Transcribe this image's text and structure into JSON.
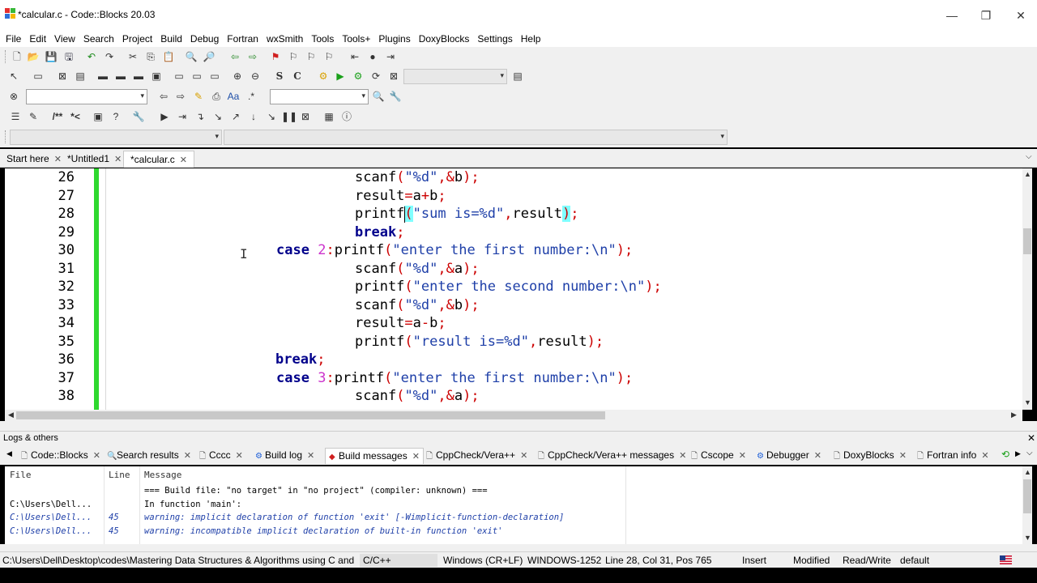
{
  "window": {
    "title": "*calcular.c - Code::Blocks 20.03",
    "minimize_glyph": "—",
    "restore_glyph": "❐",
    "close_glyph": "✕"
  },
  "menu": [
    "File",
    "Edit",
    "View",
    "Search",
    "Project",
    "Build",
    "Debug",
    "Fortran",
    "wxSmith",
    "Tools",
    "Tools+",
    "Plugins",
    "DoxyBlocks",
    "Settings",
    "Help"
  ],
  "toolbar": {
    "icons": [
      "new-file-icon",
      "open-icon",
      "save-icon",
      "save-all-icon",
      "undo-icon",
      "redo-icon",
      "cut-icon",
      "copy-icon",
      "paste-icon",
      "find-icon",
      "replace-icon",
      "jump-back-icon",
      "jump-forward-icon",
      "bookmark-toggle-icon",
      "bookmark-prev-icon",
      "bookmark-next-icon",
      "bookmark-clear-icon",
      "nav-prev-icon",
      "nav-mark-icon",
      "nav-next-icon"
    ],
    "build_target_placeholder": "",
    "search_placeholder": "",
    "symbols": [
      "S",
      "C"
    ]
  },
  "tabs": [
    {
      "label": "Start here",
      "active": false
    },
    {
      "label": "*Untitled1",
      "active": false
    },
    {
      "label": "*calcular.c",
      "active": true
    }
  ],
  "editor": {
    "lines": [
      26,
      27,
      28,
      29,
      30,
      31,
      32,
      33,
      34,
      35,
      36,
      37,
      38
    ],
    "code": [
      "scanf(\"%d\",&b);",
      "result=a+b;",
      "printf(\"sum is=%d\",result);",
      "break;",
      "case 2:printf(\"enter the first number:\\n\");",
      "scanf(\"%d\",&a);",
      "printf(\"enter the second number:\\n\");",
      "scanf(\"%d\",&b);",
      "result=a-b;",
      "printf(\"result is=%d\",result);",
      "break;",
      "case 3:printf(\"enter the first number:\\n\");",
      "scanf(\"%d\",&a);"
    ]
  },
  "logs": {
    "title": "Logs & others",
    "tabs": [
      {
        "label": "Code::Blocks",
        "icon": "doc-icon",
        "active": false
      },
      {
        "label": "Search results",
        "icon": "search-icon",
        "active": false
      },
      {
        "label": "Cccc",
        "icon": "doc-icon",
        "active": false
      },
      {
        "label": "Build log",
        "icon": "gear-icon",
        "active": false
      },
      {
        "label": "Build messages",
        "icon": "pin-icon",
        "active": true
      },
      {
        "label": "CppCheck/Vera++",
        "icon": "doc-icon",
        "active": false
      },
      {
        "label": "CppCheck/Vera++ messages",
        "icon": "doc-icon",
        "active": false
      },
      {
        "label": "Cscope",
        "icon": "doc-icon",
        "active": false
      },
      {
        "label": "Debugger",
        "icon": "gear-icon",
        "active": false
      },
      {
        "label": "DoxyBlocks",
        "icon": "doc-icon",
        "active": false
      },
      {
        "label": "Fortran info",
        "icon": "doc-icon",
        "active": false
      }
    ],
    "columns": [
      "File",
      "Line",
      "Message"
    ],
    "rows": [
      {
        "file": "",
        "line": "",
        "message": "=== Build file: \"no target\" in \"no project\" (compiler: unknown) ===",
        "warn": false
      },
      {
        "file": "C:\\Users\\Dell...",
        "line": "",
        "message": "In function 'main':",
        "warn": false
      },
      {
        "file": "C:\\Users\\Dell...",
        "line": "45",
        "message": "warning: implicit declaration of function 'exit' [-Wimplicit-function-declaration]",
        "warn": true
      },
      {
        "file": "C:\\Users\\Dell...",
        "line": "45",
        "message": "warning: incompatible implicit declaration of built-in function 'exit'",
        "warn": true
      }
    ]
  },
  "status": {
    "path": "C:\\Users\\Dell\\Desktop\\codes\\Mastering Data Structures & Algorithms using C and C+...",
    "language": "C/C++",
    "eol": "Windows (CR+LF)",
    "encoding": "WINDOWS-1252",
    "position": "Line 28, Col 31, Pos 765",
    "mode": "Insert",
    "modified": "Modified",
    "access": "Read/Write",
    "profile": "default"
  }
}
